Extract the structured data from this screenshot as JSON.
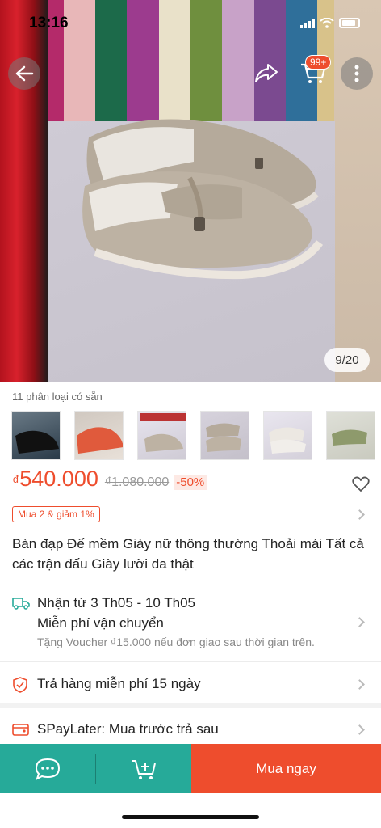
{
  "status_bar": {
    "time": "13:16"
  },
  "header": {
    "cart_badge": "99+"
  },
  "gallery": {
    "counter": "9/20"
  },
  "variants": {
    "count_label": "11 phân loại có sẵn",
    "thumbnails": [
      "black-loafer",
      "orange-loafer",
      "beige-loafer-box",
      "beige-loafer-pair",
      "white-loafer",
      "green-loafer",
      "pink-loafer"
    ]
  },
  "price": {
    "currency": "₫",
    "current": "540.000",
    "original": "₫1.080.000",
    "discount": "-50%"
  },
  "promo_tag": "Mua 2 & giảm 1%",
  "product_title": "Bàn đạp Đế mềm Giày nữ thông thường Thoải mái Tất cả các trận đấu Giày lười da thật",
  "shipping": {
    "delivery": "Nhận từ 3 Th05 - 10 Th05",
    "fee": "Miễn phí vận chuyển",
    "voucher": "Tặng Voucher ₫15.000 nếu đơn giao sau thời gian trên."
  },
  "returns": {
    "label": "Trả hàng miễn phí 15 ngày"
  },
  "paylater": {
    "label": "SPayLater: Mua trước trả sau"
  },
  "bottom_bar": {
    "buy_now": "Mua ngay"
  },
  "colors": {
    "accent": "#ee4d2d",
    "teal": "#26aa99"
  }
}
